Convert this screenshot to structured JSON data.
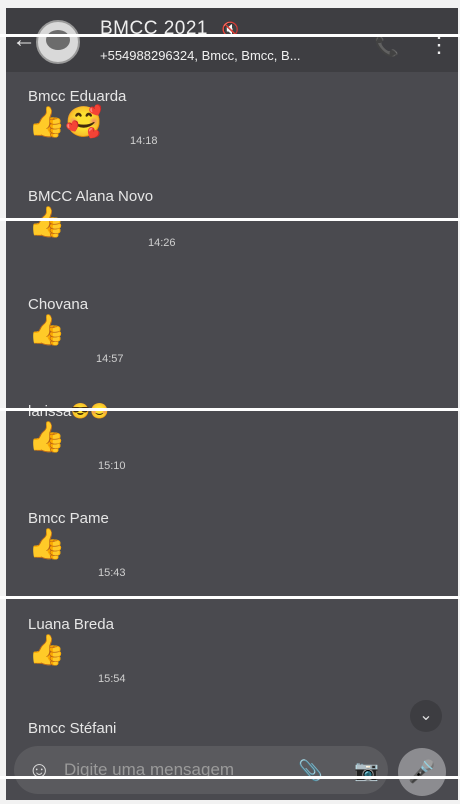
{
  "header": {
    "back_icon": "arrow-left-icon",
    "title": "BMCC 2021",
    "mute_icon": "muted-icon",
    "subtitle": "+554988296324, Bmcc, Bmcc, B...",
    "call_icon": "phone-add-icon",
    "more_icon": "more-vert-icon"
  },
  "messages": [
    {
      "sender": "Bmcc Eduarda",
      "content": "👍🥰",
      "time": "14:18"
    },
    {
      "sender": "BMCC Alana Novo",
      "content": "👍",
      "time": "14:26"
    },
    {
      "sender": "Chovana",
      "content": "👍",
      "time": "14:57"
    },
    {
      "sender": "larissa😎😊",
      "content": "👍",
      "time": "15:10"
    },
    {
      "sender": "Bmcc Pame",
      "content": "👍",
      "time": "15:43"
    },
    {
      "sender": "Luana Breda",
      "content": "👍",
      "time": "15:54"
    },
    {
      "sender": "Bmcc Stéfani",
      "content": "",
      "time": ""
    }
  ],
  "input": {
    "placeholder": "Digite uma mensagem",
    "emoji_icon": "emoji-icon",
    "attach_icon": "paperclip-icon",
    "camera_icon": "camera-icon",
    "mic_icon": "microphone-icon"
  },
  "scroll_down_icon": "double-chevron-down-icon"
}
